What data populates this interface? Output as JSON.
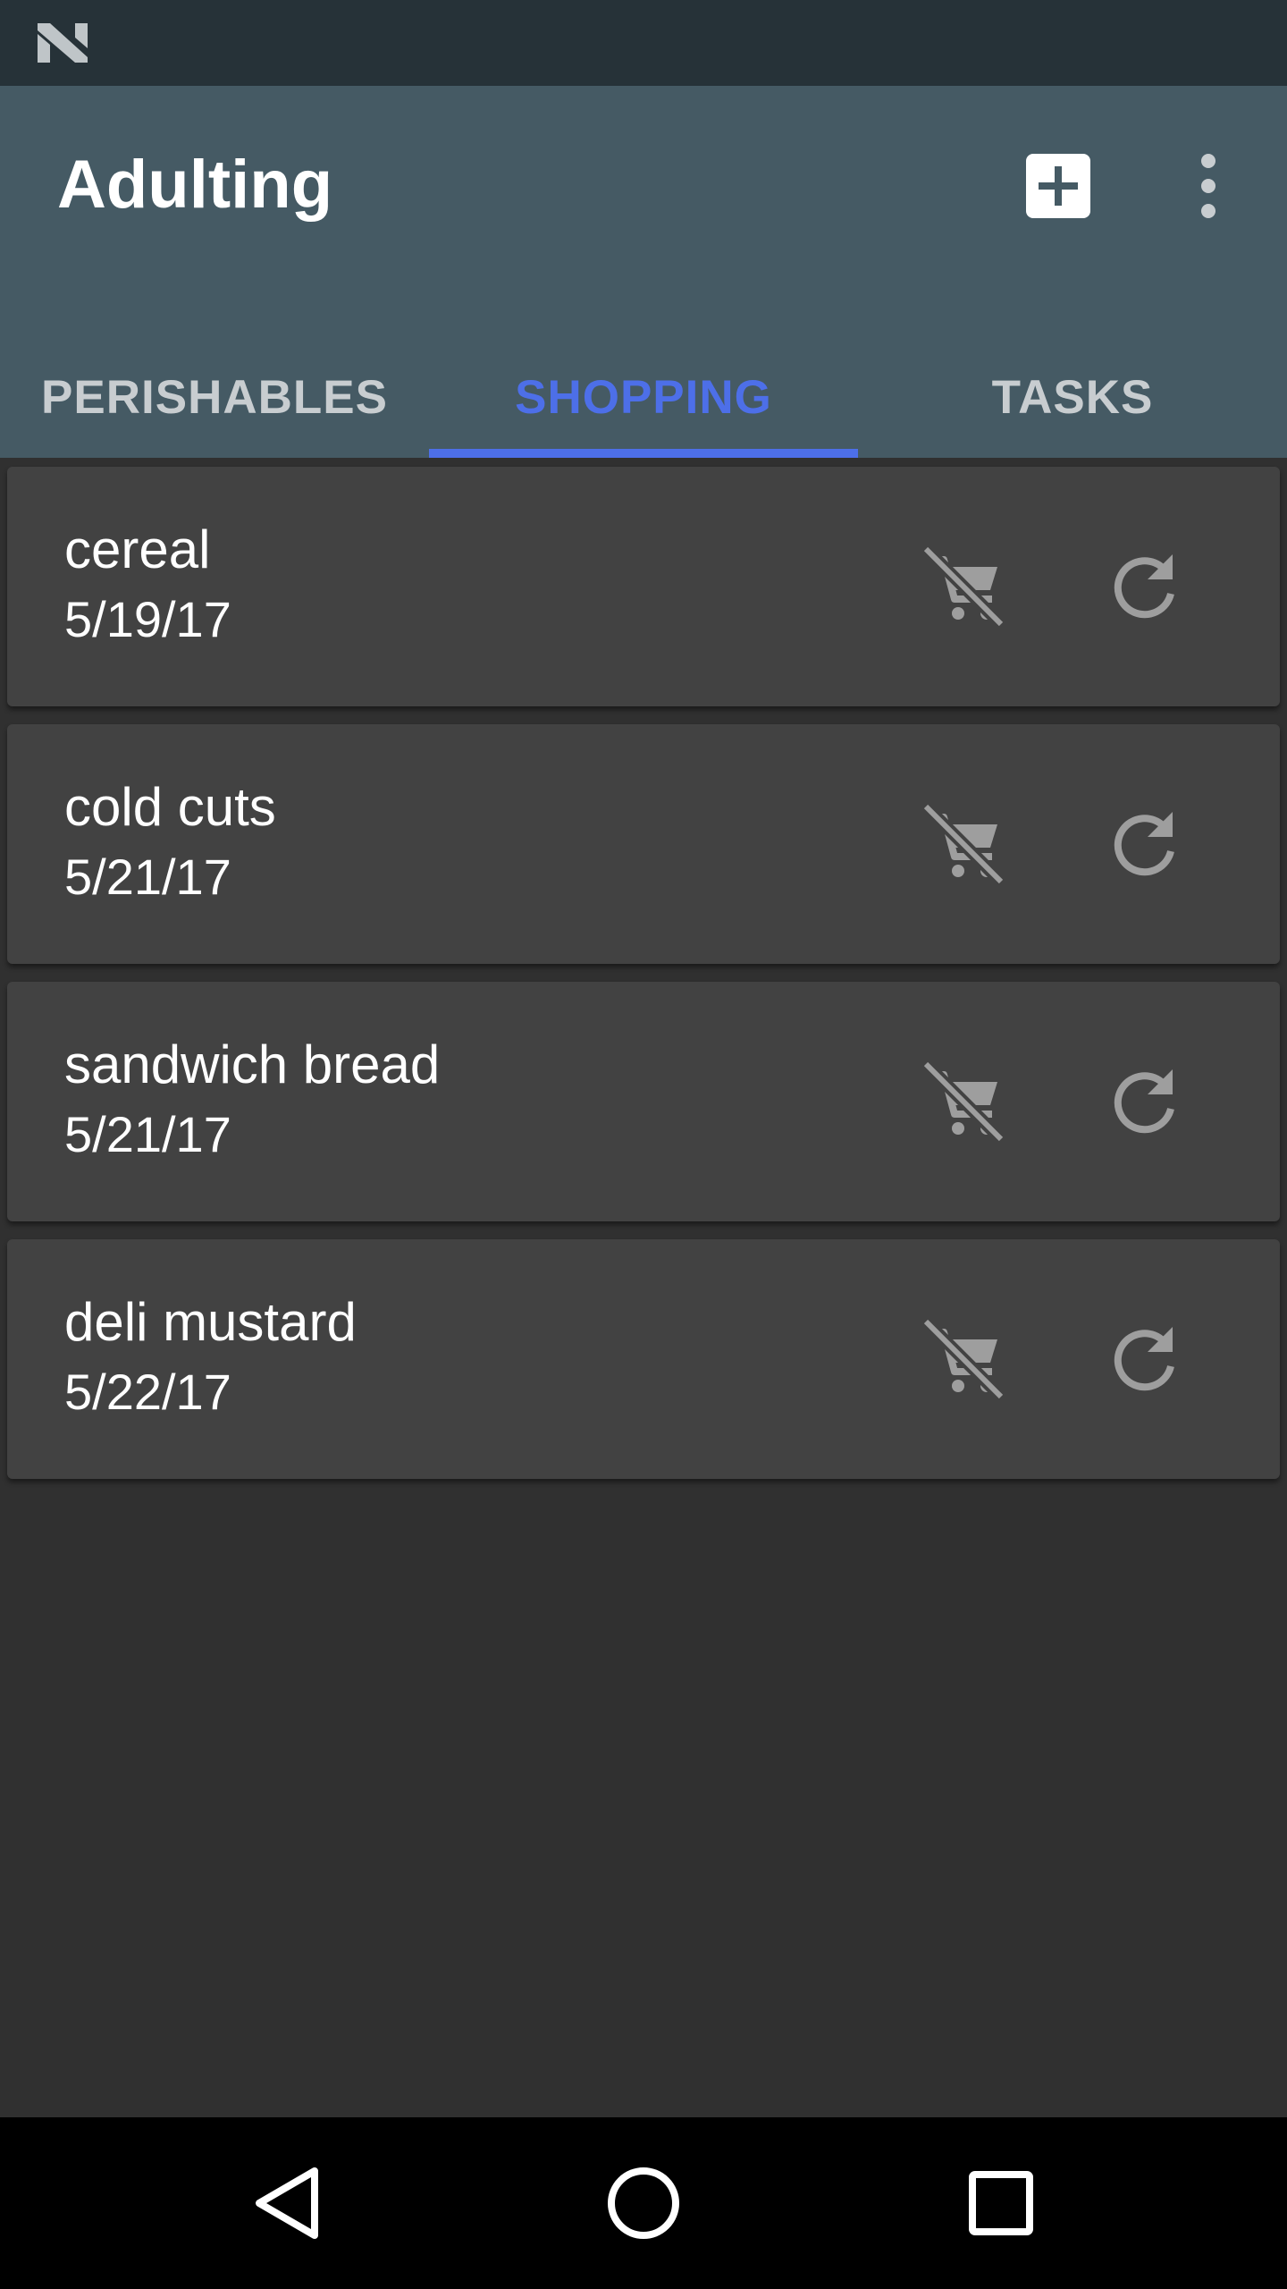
{
  "status_bar": {
    "logo_icon": "n-logo-icon"
  },
  "app_bar": {
    "title": "Adulting",
    "add_icon": "add-box-icon",
    "overflow_icon": "more-vert-icon"
  },
  "tabs": [
    {
      "label": "PERISHABLES",
      "selected": false
    },
    {
      "label": "SHOPPING",
      "selected": true
    },
    {
      "label": "TASKS",
      "selected": false
    }
  ],
  "items": [
    {
      "name": "cereal",
      "date": "5/19/17"
    },
    {
      "name": "cold cuts",
      "date": "5/21/17"
    },
    {
      "name": "sandwich bread",
      "date": "5/21/17"
    },
    {
      "name": "deli mustard",
      "date": "5/22/17"
    }
  ],
  "item_actions": {
    "cart_icon": "remove-shopping-cart-icon",
    "refresh_icon": "refresh-icon"
  },
  "nav_bar": {
    "back_icon": "back-icon",
    "home_icon": "home-icon",
    "recents_icon": "recents-icon"
  },
  "colors": {
    "status_bar": "#263238",
    "app_bar": "#455A64",
    "accent": "#4D6FE8",
    "background": "#303030",
    "card": "#424242"
  }
}
